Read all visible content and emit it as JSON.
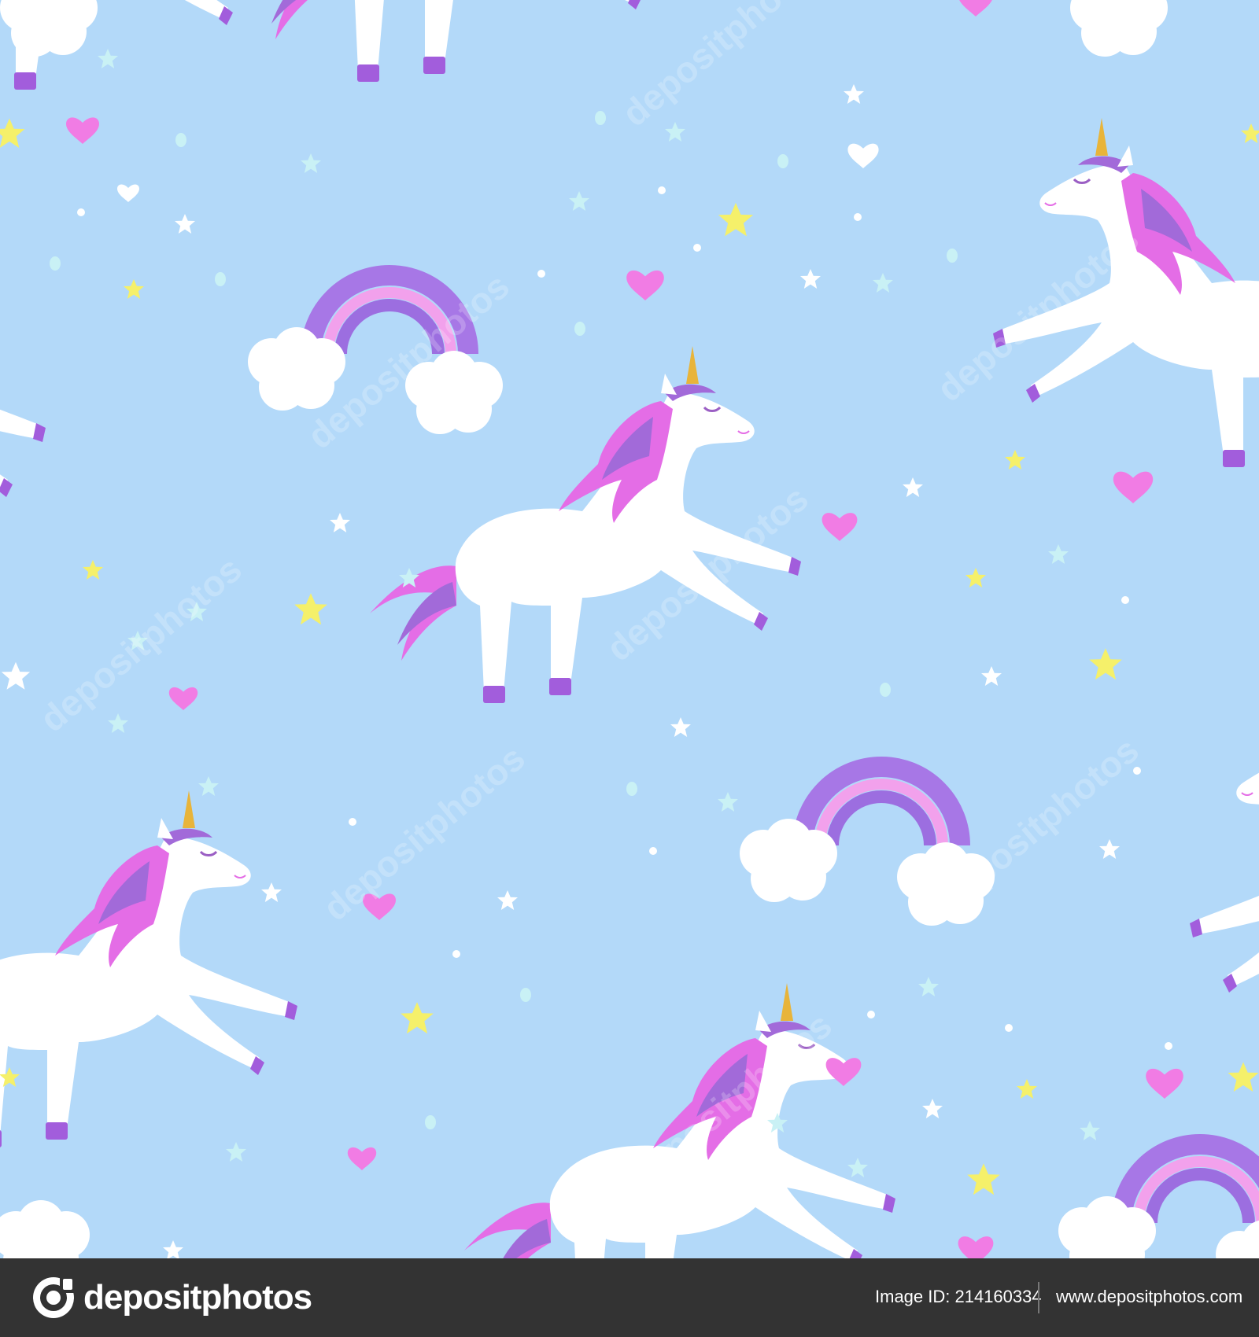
{
  "pattern": {
    "background_color": "#b3d9f9",
    "motifs": [
      "unicorn",
      "rainbow",
      "cloud",
      "star",
      "heart",
      "dot"
    ],
    "colors": {
      "unicorn_body": "#ffffff",
      "mane_pink": "#e46de6",
      "mane_purple": "#a26ad9",
      "hoof": "#a25ddc",
      "horn": "#e8b43a",
      "rainbow_outer": "#a777e6",
      "rainbow_middle": "#f2a1ec",
      "rainbow_inner": "#9c6ee0",
      "star_yellow": "#f5f06a",
      "star_white": "#ffffff",
      "star_aqua": "#c9f1f5",
      "heart_pink": "#f17ce4"
    }
  },
  "watermark": {
    "text": "depositphotos"
  },
  "footer": {
    "brand": "depositphotos",
    "image_id": "Image ID: 214160334",
    "site": "www.depositphotos.com",
    "background_color": "#333333"
  }
}
